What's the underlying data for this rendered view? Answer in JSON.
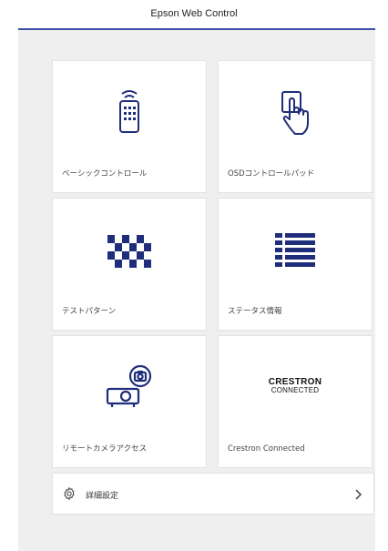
{
  "window": {
    "title": "Epson Web Control"
  },
  "colors": {
    "accent": "#3b4ea8",
    "icon": "#1f2d7a",
    "panel_bg": "#efefef"
  },
  "tiles": [
    {
      "label": "ベーシックコントロール",
      "icon": "remote-control-icon"
    },
    {
      "label": "OSDコントロールパッド",
      "icon": "touch-hand-icon"
    },
    {
      "label": "テストパターン",
      "icon": "checker-pattern-icon"
    },
    {
      "label": "ステータス情報",
      "icon": "status-list-icon"
    },
    {
      "label": "リモートカメラアクセス",
      "icon": "projector-camera-icon"
    },
    {
      "label": "Crestron Connected",
      "icon": "crestron-logo",
      "logo_line1": "CRESTRON",
      "logo_line2": "CONNECTED"
    }
  ],
  "settings_row": {
    "label": "詳細設定",
    "icon": "gear-icon",
    "chevron": "chevron-right-icon"
  }
}
